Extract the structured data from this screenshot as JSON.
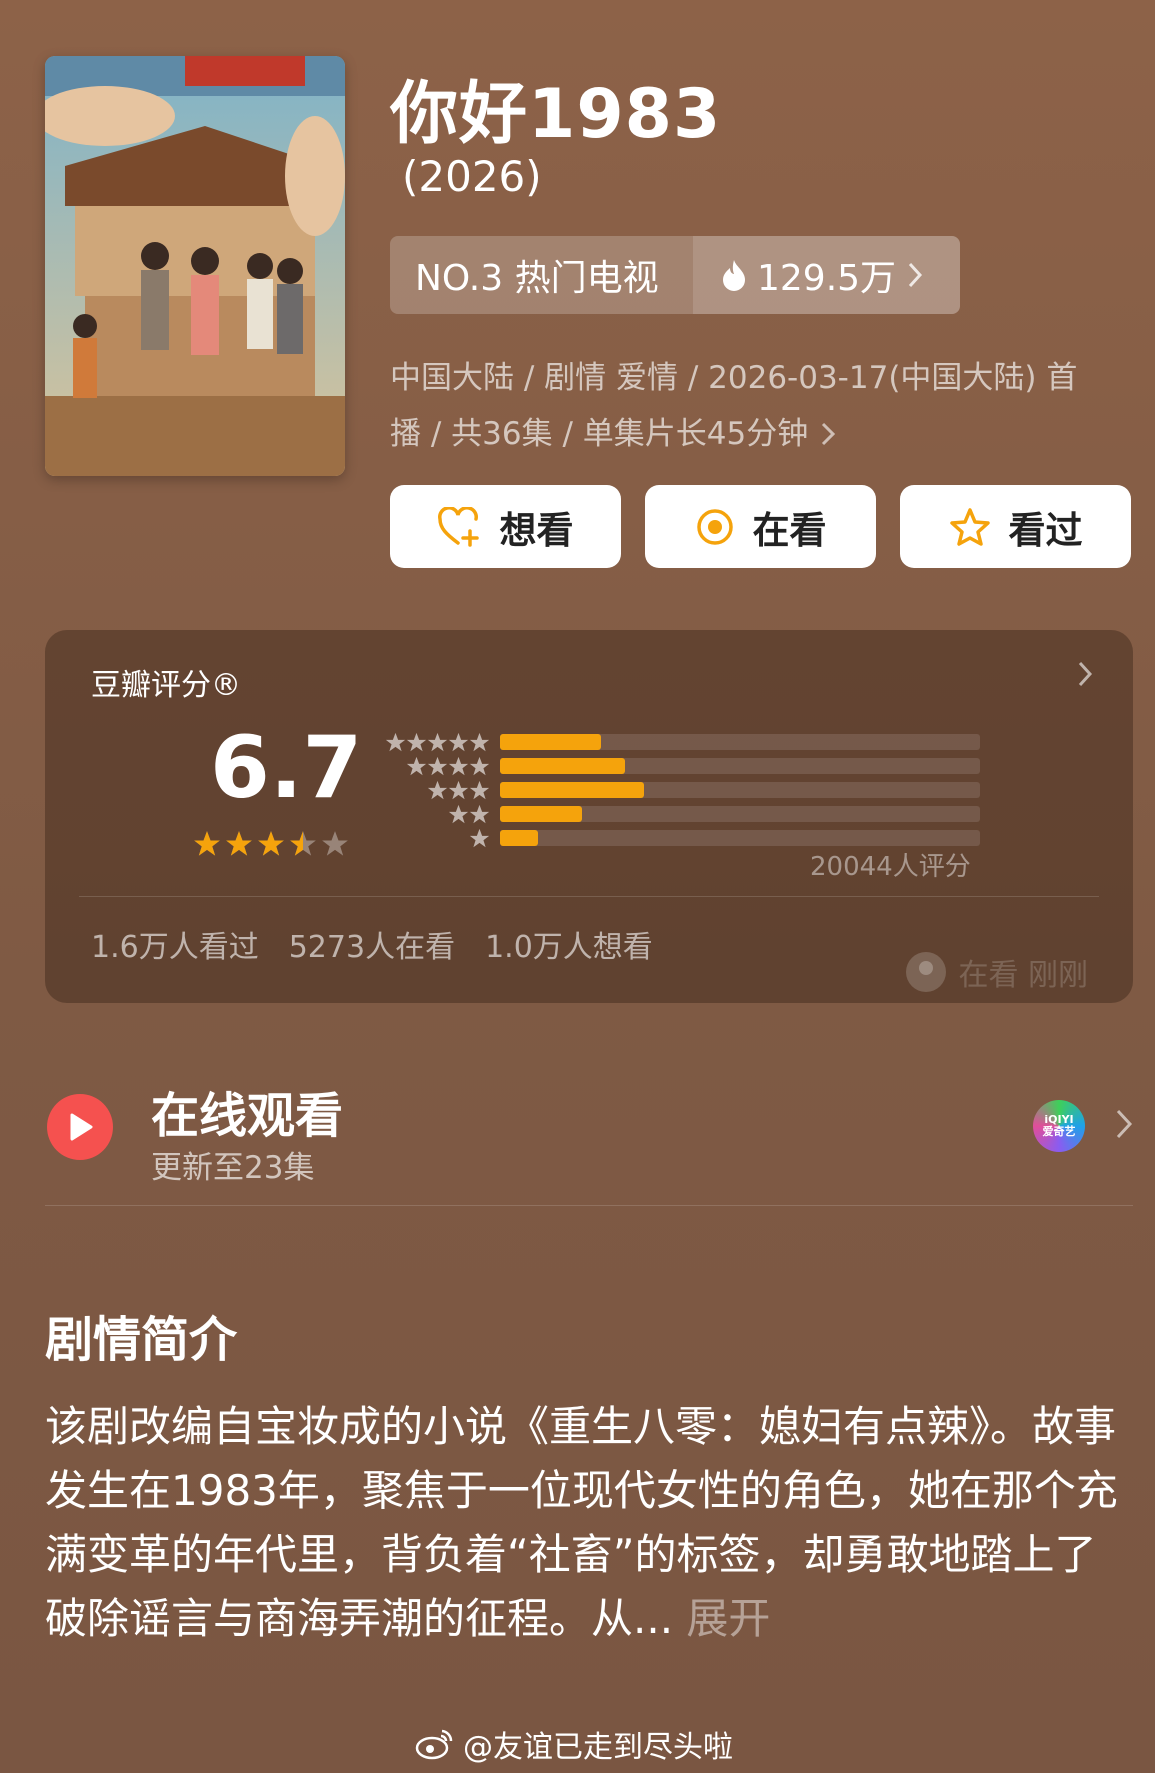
{
  "header": {
    "title": "你好1983",
    "year": "(2026)",
    "rank_label": "NO.3 热门电视",
    "heat_value": "129.5万",
    "meta_line1": "中国大陆 / 剧情 爱情 / 2026-03-17(中国大陆) 首",
    "meta_line2": "播 / 共36集 / 单集片长45分钟"
  },
  "actions": [
    {
      "label": "想看",
      "icon": "heart-plus-icon"
    },
    {
      "label": "在看",
      "icon": "target-icon"
    },
    {
      "label": "看过",
      "icon": "star-outline-icon"
    }
  ],
  "rating": {
    "title": "豆瓣评分®",
    "score": "6.7",
    "stars": 3.5,
    "distribution_percent": [
      21,
      26,
      30,
      17,
      8
    ],
    "count_text": "20044人评分",
    "watched": "1.6万人看过",
    "watching": "5273人在看",
    "want": "1.0万人想看",
    "recent_activity": "在看 刚刚"
  },
  "online": {
    "title": "在线观看",
    "subtitle": "更新至23集",
    "platform_top": "iQIYI",
    "platform_bottom": "爱奇艺"
  },
  "synopsis": {
    "title": "剧情简介",
    "text": "该剧改编自宝妆成的小说《重生八零：媳妇有点辣》。故事发生在1983年，聚焦于一位现代女性的角色，她在那个充满变革的年代里，背负着“社畜”的标签，却勇敢地踏上了破除谣言与商海弄潮的征程。从...",
    "expand": "展开"
  },
  "watermark": "@友谊已走到尽头啦",
  "colors": {
    "accent": "#f5a30c",
    "play": "#f5514f"
  }
}
